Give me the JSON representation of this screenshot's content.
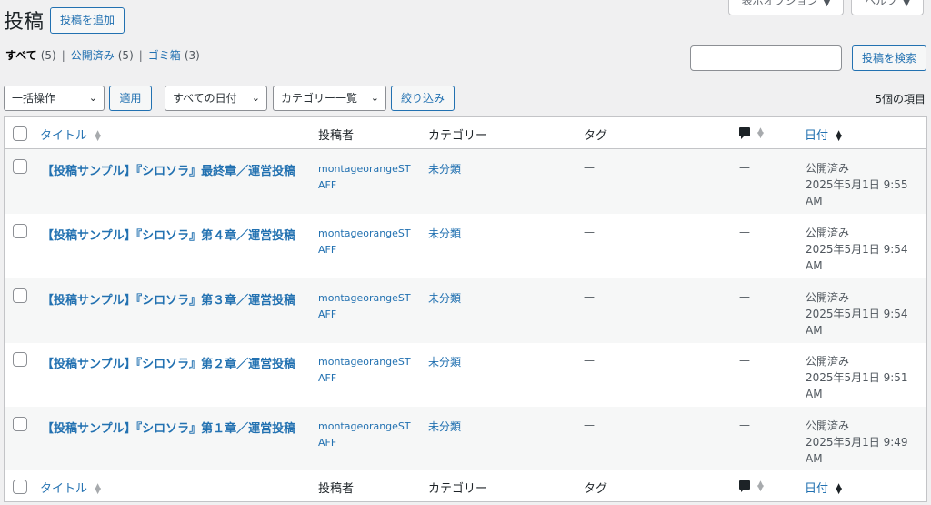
{
  "screen_meta": {
    "display_options": "表示オプション",
    "help": "ヘルプ"
  },
  "header": {
    "title": "投稿",
    "add_new": "投稿を追加"
  },
  "views": [
    {
      "label": "すべて",
      "count": "(5)"
    },
    {
      "label": "公開済み",
      "count": "(5)"
    },
    {
      "label": "ゴミ箱",
      "count": "(3)"
    }
  ],
  "views_separator": "|",
  "search": {
    "value": "",
    "button": "投稿を検索"
  },
  "tablenav": {
    "bulk_action": "一括操作",
    "apply": "適用",
    "date_filter": "すべての日付",
    "category_filter": "カテゴリー一覧",
    "filter": "絞り込み",
    "items_count": "5個の項目"
  },
  "columns": {
    "title": "タイトル",
    "author": "投稿者",
    "categories": "カテゴリー",
    "tags": "タグ",
    "date": "日付"
  },
  "icons": {
    "sort": "sort-arrows-icon",
    "comments": "comment-bubble-icon"
  },
  "rows": [
    {
      "title": "【投稿サンプル】『シロソラ』最終章／運営投稿",
      "author": "montageorangeSTAFF",
      "category": "未分類",
      "tags": "—",
      "comments": "—",
      "status": "公開済み",
      "date": "2025年5月1日 9:55",
      "ampm": "AM"
    },
    {
      "title": "【投稿サンプル】『シロソラ』第４章／運営投稿",
      "author": "montageorangeSTAFF",
      "category": "未分類",
      "tags": "—",
      "comments": "—",
      "status": "公開済み",
      "date": "2025年5月1日 9:54",
      "ampm": "AM"
    },
    {
      "title": "【投稿サンプル】『シロソラ』第３章／運営投稿",
      "author": "montageorangeSTAFF",
      "category": "未分類",
      "tags": "—",
      "comments": "—",
      "status": "公開済み",
      "date": "2025年5月1日 9:54",
      "ampm": "AM"
    },
    {
      "title": "【投稿サンプル】『シロソラ』第２章／運営投稿",
      "author": "montageorangeSTAFF",
      "category": "未分類",
      "tags": "—",
      "comments": "—",
      "status": "公開済み",
      "date": "2025年5月1日 9:51",
      "ampm": "AM"
    },
    {
      "title": "【投稿サンプル】『シロソラ』第１章／運営投稿",
      "author": "montageorangeSTAFF",
      "category": "未分類",
      "tags": "—",
      "comments": "—",
      "status": "公開済み",
      "date": "2025年5月1日 9:49",
      "ampm": "AM"
    }
  ],
  "colors": {
    "accent": "#2271b1",
    "background": "#f0f0f1",
    "text": "#1d2327",
    "border": "#c3c4c7"
  }
}
